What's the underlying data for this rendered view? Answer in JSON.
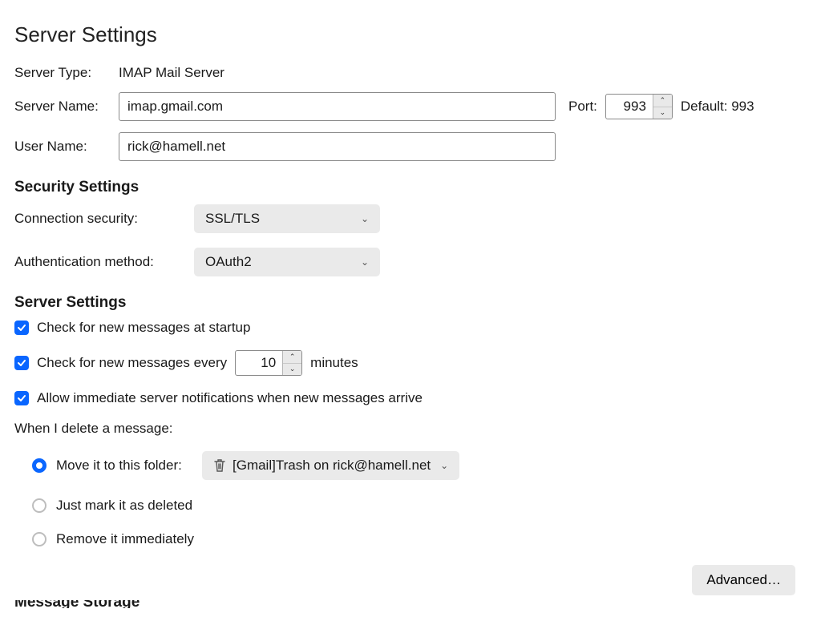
{
  "page_title": "Server Settings",
  "server_type_label": "Server Type:",
  "server_type_value": "IMAP Mail Server",
  "server_name_label": "Server Name:",
  "server_name_value": "imap.gmail.com",
  "port_label": "Port:",
  "port_value": "993",
  "port_default_label": "Default: 993",
  "user_name_label": "User Name:",
  "user_name_value": "rick@hamell.net",
  "security": {
    "heading": "Security Settings",
    "conn_label": "Connection security:",
    "conn_value": "SSL/TLS",
    "auth_label": "Authentication method:",
    "auth_value": "OAuth2"
  },
  "serverSettings": {
    "heading": "Server Settings",
    "check_startup": {
      "checked": true,
      "label": "Check for new messages at startup"
    },
    "check_every": {
      "checked": true,
      "label_before": "Check for new messages every",
      "value": "10",
      "label_after": "minutes"
    },
    "allow_notifications": {
      "checked": true,
      "label": "Allow immediate server notifications when new messages arrive"
    },
    "delete_heading": "When I delete a message:",
    "delete_options": {
      "move": {
        "selected": true,
        "label": "Move it to this folder:",
        "folder": "[Gmail]Trash on rick@hamell.net"
      },
      "mark": {
        "selected": false,
        "label": "Just mark it as deleted"
      },
      "remove": {
        "selected": false,
        "label": "Remove it immediately"
      }
    },
    "advanced_label": "Advanced…"
  },
  "cutoff_heading": "Message Storage"
}
